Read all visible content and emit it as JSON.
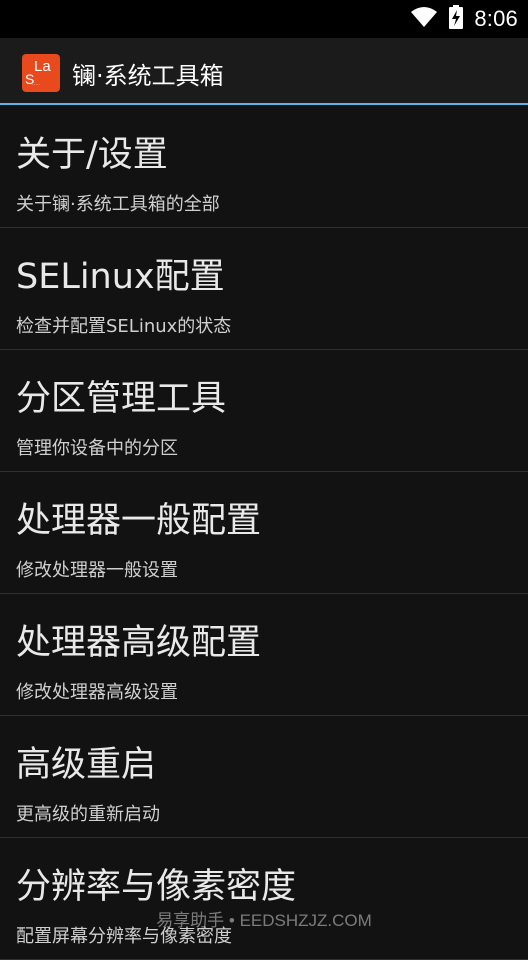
{
  "status": {
    "time": "8:06"
  },
  "appbar": {
    "title": "镧·系统工具箱",
    "icon_text": "La",
    "icon_s": "S"
  },
  "items": [
    {
      "title": "关于/设置",
      "subtitle": "关于镧·系统工具箱的全部"
    },
    {
      "title": "SELinux配置",
      "subtitle": "检查并配置SELinux的状态"
    },
    {
      "title": "分区管理工具",
      "subtitle": "管理你设备中的分区"
    },
    {
      "title": "处理器一般配置",
      "subtitle": "修改处理器一般设置"
    },
    {
      "title": "处理器高级配置",
      "subtitle": "修改处理器高级设置"
    },
    {
      "title": "高级重启",
      "subtitle": "更高级的重新启动"
    },
    {
      "title": "分辨率与像素密度",
      "subtitle": "配置屏幕分辨率与像素密度"
    }
  ],
  "watermark": "易享助手 • EEDSHZJZ.COM"
}
